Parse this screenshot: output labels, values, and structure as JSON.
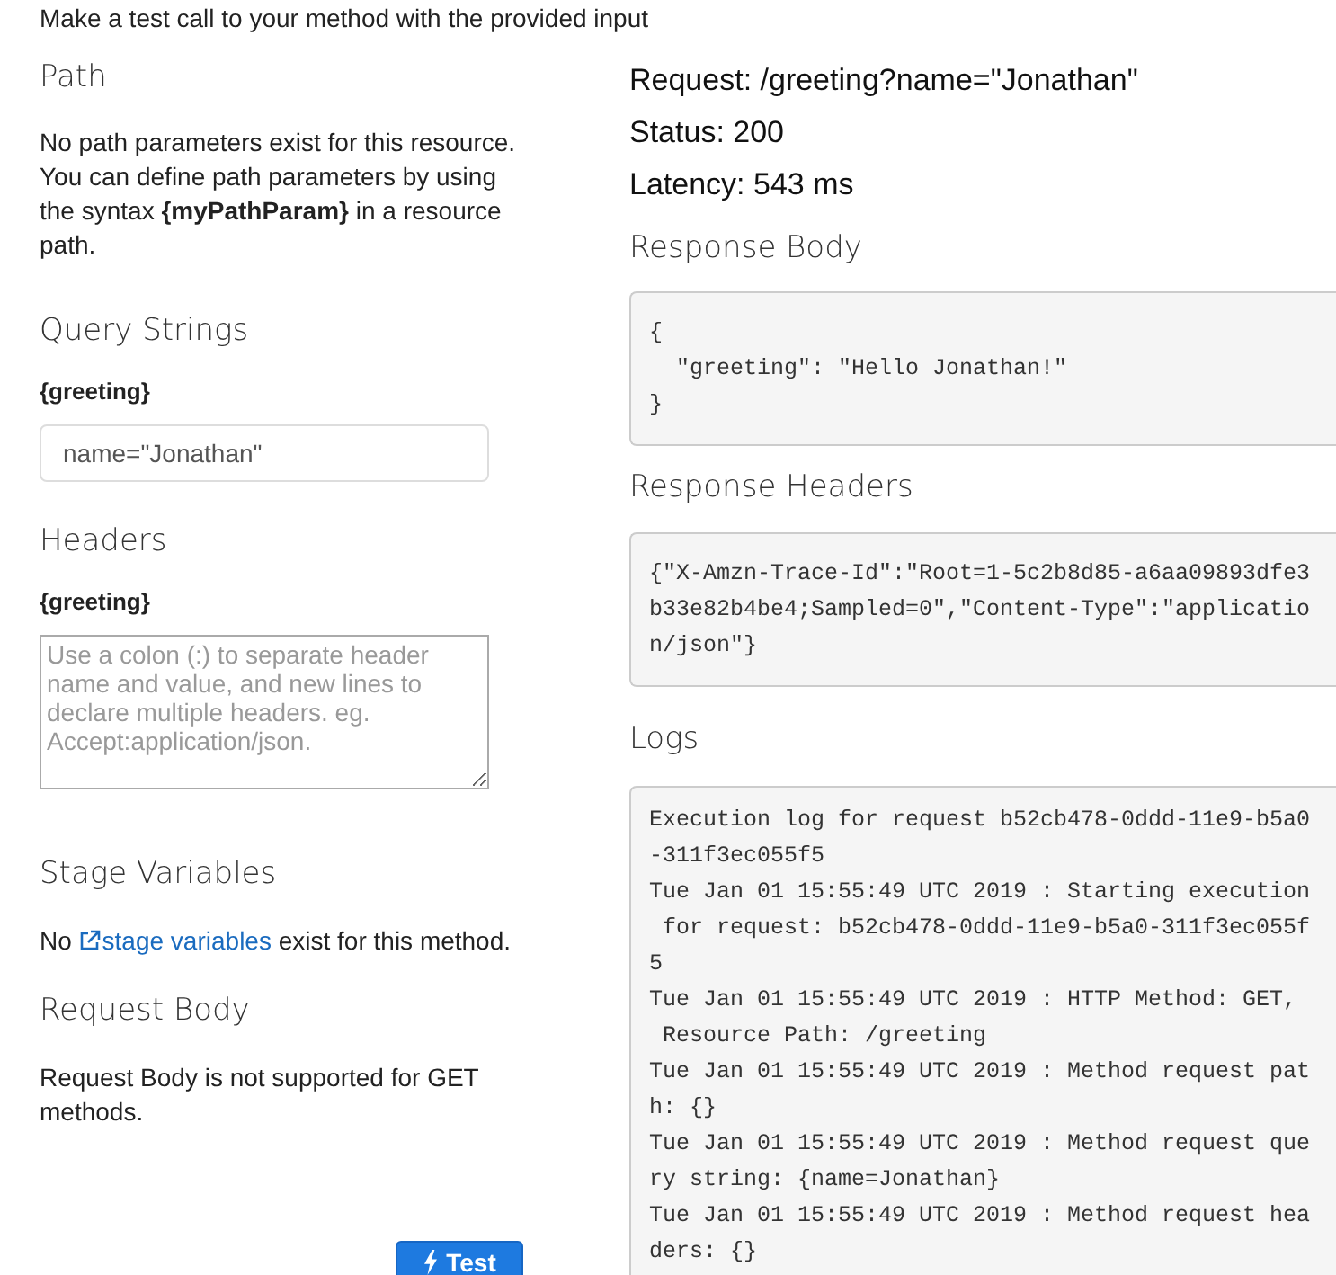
{
  "instruction": "Make a test call to your method with the provided input",
  "left": {
    "path": {
      "title": "Path",
      "text": "No path parameters exist for this resource. You can define path parameters by using the syntax **{myPathParam}** in a resource path."
    },
    "query_strings": {
      "title": "Query Strings",
      "label": "{greeting}",
      "value": "name=\"Jonathan\""
    },
    "headers": {
      "title": "Headers",
      "label": "{greeting}",
      "placeholder": "Use a colon (:) to separate header name and value, and new lines to declare multiple headers. eg. Accept:application/json."
    },
    "stage_variables": {
      "title": "Stage Variables",
      "before": "No",
      "link": "stage variables",
      "after": "exist for this method."
    },
    "request_body": {
      "title": "Request Body",
      "text": "Request Body is not supported for GET methods."
    },
    "test_button": "Test"
  },
  "right": {
    "request": "Request: /greeting?name=\"Jonathan\"",
    "status": "Status: 200",
    "latency": "Latency: 543 ms",
    "response_body": {
      "title": "Response Body",
      "lines": [
        "{",
        "  \"greeting\": \"Hello Jonathan!\"",
        "}"
      ]
    },
    "response_headers": {
      "title": "Response Headers",
      "lines": [
        "{\"X-Amzn-Trace-Id\":\"Root=1-5c2b8d85-a6aa09893dfe3",
        "b33e82b4be4;Sampled=0\",\"Content-Type\":\"applicatio",
        "n/json\"}"
      ]
    },
    "logs": {
      "title": "Logs",
      "lines": [
        "Execution log for request b52cb478-0ddd-11e9-b5a0",
        "-311f3ec055f5",
        "Tue Jan 01 15:55:49 UTC 2019 : Starting execution",
        " for request: b52cb478-0ddd-11e9-b5a0-311f3ec055f",
        "5",
        "Tue Jan 01 15:55:49 UTC 2019 : HTTP Method: GET,",
        " Resource Path: /greeting",
        "Tue Jan 01 15:55:49 UTC 2019 : Method request pat",
        "h: {}",
        "Tue Jan 01 15:55:49 UTC 2019 : Method request que",
        "ry string: {name=Jonathan}",
        "Tue Jan 01 15:55:49 UTC 2019 : Method request hea",
        "ders: {}"
      ]
    }
  }
}
